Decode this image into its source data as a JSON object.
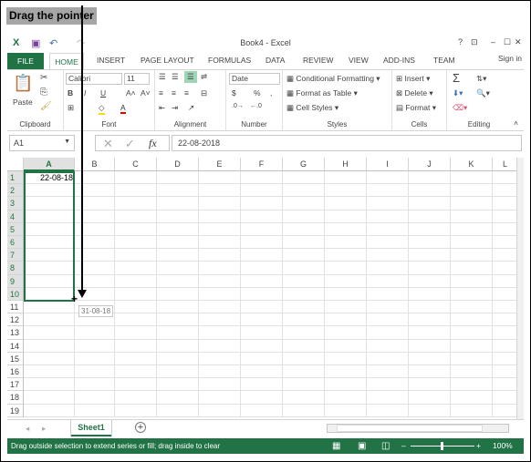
{
  "annotation": {
    "text": "Drag the pointer"
  },
  "window": {
    "title": "Book4 - Excel",
    "help": "?",
    "minimize": "–",
    "maximize": "☐",
    "close": "✕"
  },
  "tabs": {
    "file": "FILE",
    "home": "HOME",
    "items": [
      "INSERT",
      "PAGE LAYOUT",
      "FORMULAS",
      "DATA",
      "REVIEW",
      "VIEW",
      "ADD-INS",
      "TEAM"
    ],
    "sign_in": "Sign in"
  },
  "ribbon": {
    "clipboard": {
      "label": "Clipboard",
      "paste": "Paste"
    },
    "font": {
      "label": "Font",
      "name": "Calibri",
      "size": "11",
      "bold": "B",
      "italic": "I",
      "underline": "U"
    },
    "alignment": {
      "label": "Alignment"
    },
    "number": {
      "label": "Number",
      "format": "Date",
      "currency": "$",
      "percent": "%",
      "comma": ","
    },
    "styles": {
      "label": "Styles",
      "conditional": "Conditional Formatting",
      "table": "Format as Table",
      "cell_styles": "Cell Styles"
    },
    "cells": {
      "label": "Cells",
      "insert": "Insert",
      "delete": "Delete",
      "format": "Format"
    },
    "editing": {
      "label": "Editing",
      "sum": "Σ"
    }
  },
  "formula_bar": {
    "name_box": "A1",
    "fx": "fx",
    "value": "22-08-2018"
  },
  "grid": {
    "columns": [
      "A",
      "B",
      "C",
      "D",
      "E",
      "F",
      "G",
      "H",
      "I",
      "J",
      "K",
      "L"
    ],
    "rows": 19,
    "cell_a1": "22-08-18",
    "fill_tooltip": "31-08-18"
  },
  "sheets": {
    "active": "Sheet1",
    "add": "+"
  },
  "status": {
    "message": "Drag outside selection to extend series or fill; drag inside to clear",
    "zoom": "100%"
  },
  "colors": {
    "accent": "#217346"
  }
}
